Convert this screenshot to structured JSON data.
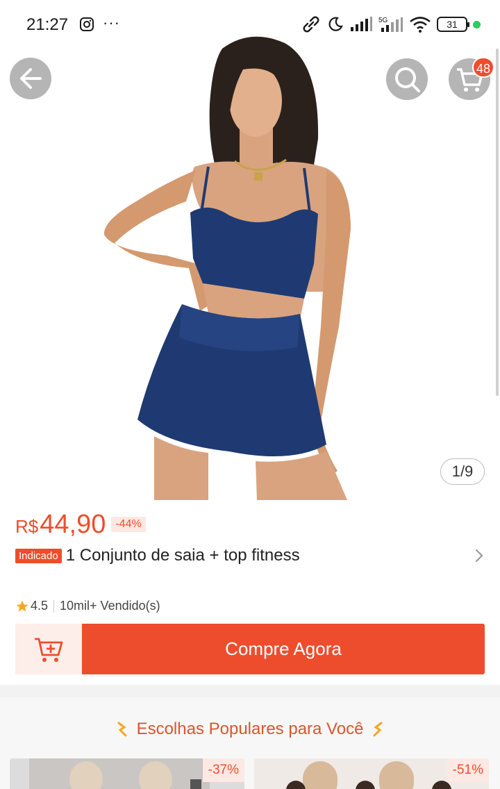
{
  "status_bar": {
    "time": "21:27",
    "battery": "31"
  },
  "header": {
    "cart_count": "48"
  },
  "gallery": {
    "pager": "1/9"
  },
  "product": {
    "currency": "R$",
    "price": "44,90",
    "discount": "-44%",
    "tag": "Indicado",
    "title": "1 Conjunto de saia + top fitness",
    "rating": "4.5",
    "sold": "10mil+ Vendido(s)"
  },
  "actions": {
    "buy_label": "Compre Agora"
  },
  "popular": {
    "title": "Escolhas Populares para Você",
    "cards": [
      {
        "discount": "-37%"
      },
      {
        "discount": "-51%"
      }
    ]
  },
  "colors": {
    "accent": "#ee4d2d",
    "outfit": "#1f3a72"
  }
}
